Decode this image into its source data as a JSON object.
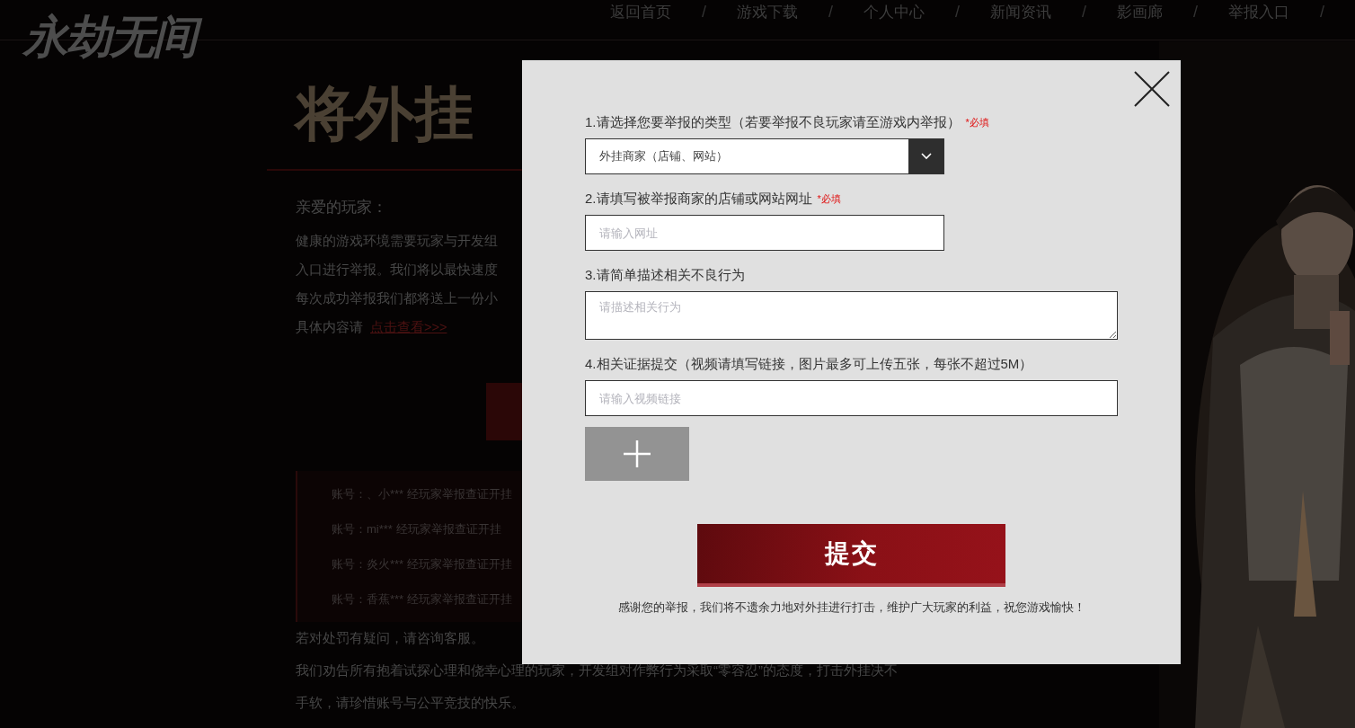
{
  "logo": "永劫无间",
  "nav": {
    "items": [
      {
        "label": "返回首页"
      },
      {
        "label": "游戏下载"
      },
      {
        "label": "个人中心"
      },
      {
        "label": "新闻资讯"
      },
      {
        "label": "影画廊"
      },
      {
        "label": "举报入口"
      }
    ],
    "separator": "/"
  },
  "page": {
    "title": "将外挂",
    "greeting": "亲爱的玩家：",
    "paragraph_lines": [
      "健康的游戏环境需要玩家与开发组",
      "入口进行举报。我们将以最快速度",
      "每次成功举报我们都将送上一份小"
    ],
    "detail": {
      "text": "具体内容请",
      "link": "点击查看>>>"
    },
    "records": [
      "账号：、小*** 经玩家举报查证开挂",
      "账号：mi*** 经玩家举报查证开挂",
      "账号：炎火*** 经玩家举报查证开挂",
      "账号：香蕉*** 经玩家举报查证开挂"
    ],
    "footer_lines": [
      "若对处罚有疑问，请咨询客服。",
      "我们劝告所有抱着试探心理和侥幸心理的玩家，开发组对作弊行为采取“零容忍”的态度，打击外挂决不",
      "手软，请珍惜账号与公平竞技的快乐。"
    ]
  },
  "dialog": {
    "fields": [
      {
        "kind": "select",
        "label": "1.请选择您要举报的类型（若要举报不良玩家请至游戏内举报）",
        "required_mark": "*必填",
        "value": "外挂商家（店铺、网站）"
      },
      {
        "kind": "input",
        "label": "2.请填写被举报商家的店铺或网站网址",
        "required_mark": "*必填",
        "placeholder": "请输入网址"
      },
      {
        "kind": "textarea",
        "label": "3.请简单描述相关不良行为",
        "placeholder": "请描述相关行为"
      },
      {
        "kind": "wide_input",
        "label": "4.相关证据提交（视频请填写链接，图片最多可上传五张，每张不超过5M）",
        "placeholder": "请输入视频链接"
      }
    ],
    "submit": "提交",
    "note": "感谢您的举报，我们将不遗余力地对外挂进行打击，维护广大玩家的利益，祝您游戏愉快！"
  }
}
